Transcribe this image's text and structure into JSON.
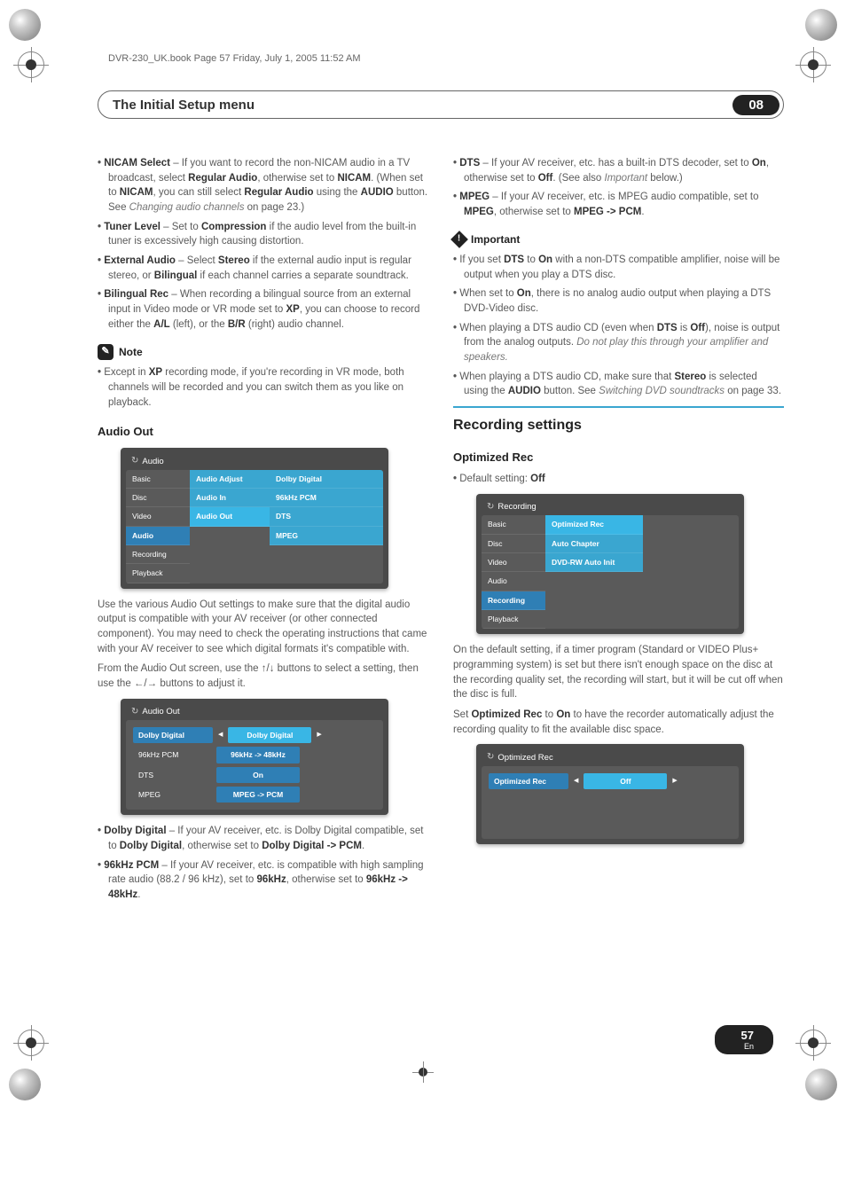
{
  "bookline": "DVR-230_UK.book  Page 57  Friday, July 1, 2005  11:52 AM",
  "titlebar": {
    "title": "The Initial Setup menu",
    "badge": "08"
  },
  "left": {
    "items": [
      {
        "label": "NICAM Select",
        "text": " – If you want to record the non-NICAM audio in a TV broadcast, select ",
        "b1": "Regular Audio",
        "text2": ", otherwise set to ",
        "b2": "NICAM",
        "text3": ". (When set to ",
        "b3": "NICAM",
        "text4": ", you can still select ",
        "b4": "Regular Audio",
        "text5": " using the ",
        "b5": "AUDIO",
        "text6": " button. See ",
        "i1": "Changing audio channels",
        "text7": " on page 23.)"
      },
      {
        "label": "Tuner Level",
        "text": " – Set to ",
        "b1": "Compression",
        "text2": " if the audio level from the built-in tuner is excessively high causing distortion."
      },
      {
        "label": "External Audio",
        "text": " – Select ",
        "b1": "Stereo",
        "text2": " if the external audio input is regular stereo, or ",
        "b2": "Bilingual",
        "text3": " if each channel carries a separate soundtrack."
      },
      {
        "label": "Bilingual Rec",
        "text": " – When recording a bilingual source from an external input in Video mode or VR mode set to ",
        "b1": "XP",
        "text2": ", you can choose to record either the ",
        "b2": "A/L",
        "text3": " (left), or the ",
        "b3": "B/R",
        "text4": " (right) audio channel."
      }
    ],
    "note_label": "Note",
    "note_text1": "Except in ",
    "note_b1": "XP",
    "note_text2": " recording mode, if you're recording in VR mode, both channels will be recorded and you can switch them as you like on playback.",
    "audio_out_h": "Audio Out",
    "panel1": {
      "title": "Audio",
      "col1": [
        "Basic",
        "Disc",
        "Video",
        "Audio",
        "Recording",
        "Playback"
      ],
      "col2": [
        "Audio Adjust",
        "Audio In",
        "Audio Out"
      ],
      "col3": [
        "Dolby Digital",
        "96kHz PCM",
        "DTS",
        "MPEG"
      ]
    },
    "para1": "Use the various Audio Out settings to make sure that the digital audio output is compatible with your AV receiver (or other connected component). You may need to check the operating instructions that came with your AV receiver to see which digital formats it's compatible with.",
    "para2a": "From the Audio Out screen, use the ",
    "para2b": " buttons to select a setting, then use the ",
    "para2c": " buttons to adjust it.",
    "panel2": {
      "title": "Audio Out",
      "rows": [
        {
          "l": "Dolby Digital",
          "v": "Dolby Digital"
        },
        {
          "l": "96kHz PCM",
          "v": "96kHz -> 48kHz"
        },
        {
          "l": "DTS",
          "v": "On"
        },
        {
          "l": "MPEG",
          "v": "MPEG -> PCM"
        }
      ]
    },
    "items2": [
      {
        "label": "Dolby Digital",
        "t1": " – If your AV receiver, etc. is Dolby Digital compatible, set to ",
        "b1": "Dolby Digital",
        "t2": ", otherwise set to ",
        "b2": "Dolby Digital -> PCM",
        "t3": "."
      },
      {
        "label": "96kHz PCM",
        "t1": " – If your AV receiver, etc. is compatible with high sampling rate audio (88.2 / 96 kHz), set to ",
        "b1": "96kHz",
        "t2": ", otherwise set to ",
        "b2": "96kHz -> 48kHz",
        "t3": "."
      }
    ]
  },
  "right": {
    "items": [
      {
        "label": "DTS",
        "t1": " – If your AV receiver, etc. has a built-in DTS decoder, set to ",
        "b1": "On",
        "t2": ", otherwise set to ",
        "b2": "Off",
        "t3": ". (See also ",
        "i1": "Important",
        "t4": " below.)"
      },
      {
        "label": "MPEG",
        "t1": " – If your AV receiver, etc. is MPEG audio compatible, set to ",
        "b1": "MPEG",
        "t2": ", otherwise set to ",
        "b2": "MPEG -> PCM",
        "t3": "."
      }
    ],
    "imp_label": "Important",
    "imp_items": [
      {
        "t1": "If you set ",
        "b1": "DTS",
        "t2": " to ",
        "b2": "On",
        "t3": " with a non-DTS compatible amplifier, noise will be output when you play a DTS disc."
      },
      {
        "t1": "When set to ",
        "b1": "On",
        "t2": ", there is no analog audio output when playing a DTS DVD-Video disc."
      },
      {
        "t1": "When playing a DTS audio CD (even when ",
        "b1": "DTS",
        "t2": " is ",
        "b2": "Off",
        "t3": "), noise is output from the analog outputs. ",
        "i1": "Do not play this through your amplifier and speakers."
      },
      {
        "t1": "When playing a DTS audio CD, make sure that ",
        "b1": "Stereo",
        "t2": " is selected using the ",
        "b2": "AUDIO",
        "t3": " button. See ",
        "i1": "Switching DVD soundtracks",
        "t4": " on page 33."
      }
    ],
    "rec_h": "Recording settings",
    "opt_h": "Optimized Rec",
    "opt_default_a": "Default setting: ",
    "opt_default_b": "Off",
    "panel3": {
      "title": "Recording",
      "col1": [
        "Basic",
        "Disc",
        "Video",
        "Audio",
        "Recording",
        "Playback"
      ],
      "col2": [
        "Optimized Rec",
        "Auto Chapter",
        "DVD-RW Auto Init"
      ]
    },
    "para3": "On the default setting, if a timer program (Standard or VIDEO Plus+ programming system) is set but there isn't enough space on the disc at the recording quality set, the recording will start, but it will be cut off when the disc is full.",
    "para4a": "Set ",
    "para4b": "Optimized Rec",
    "para4c": " to ",
    "para4d": "On",
    "para4e": " to have the recorder automatically adjust the recording quality to fit the available disc space.",
    "panel4": {
      "title": "Optimized Rec",
      "label": "Optimized Rec",
      "value": "Off"
    }
  },
  "arrows": {
    "updown": "↑/↓",
    "leftright": "←/→"
  },
  "pagenum": "57",
  "pagelang": "En"
}
